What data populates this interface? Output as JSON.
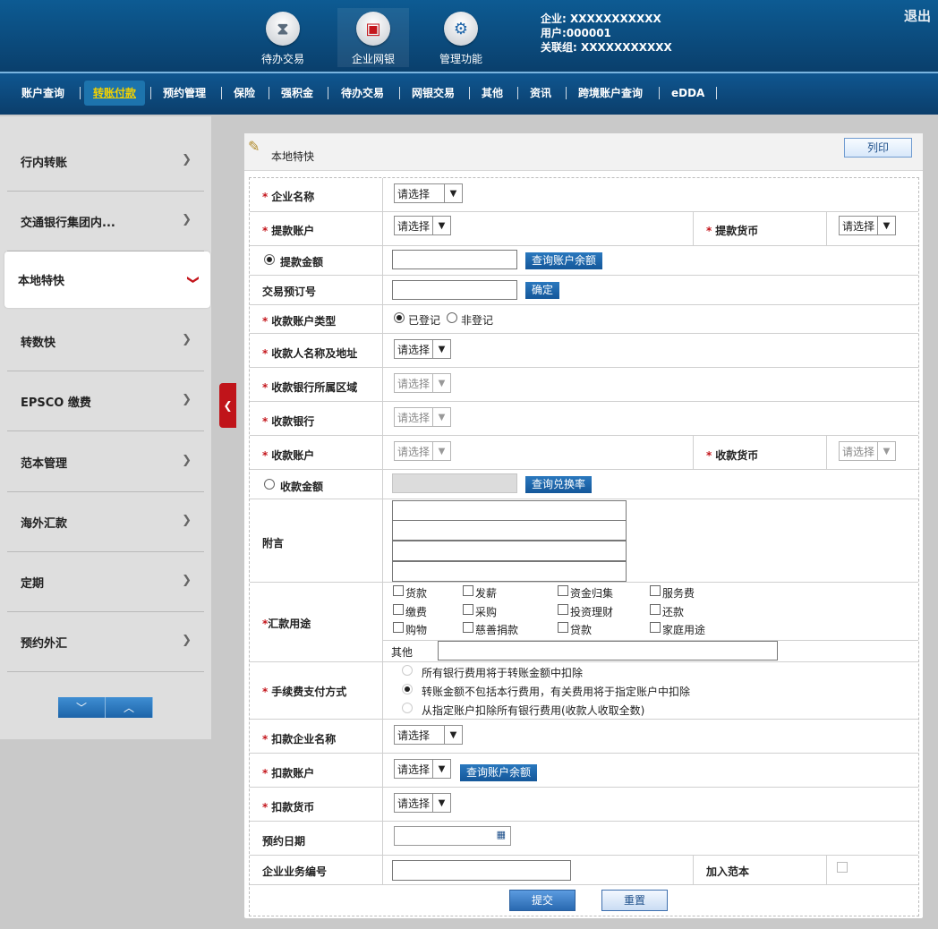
{
  "header": {
    "icons": [
      {
        "label": "待办交易",
        "icon": "hourglass-icon"
      },
      {
        "label": "企业网银",
        "icon": "monitor-icon"
      },
      {
        "label": "管理功能",
        "icon": "gear-icon"
      }
    ],
    "company_line": "企业: XXXXXXXXXXX",
    "user_line": "用户:000001",
    "group_line": "关联组: XXXXXXXXXXX",
    "logout": "退出"
  },
  "nav": [
    "账户查询",
    "转账付款",
    "预约管理",
    "保险",
    "强积金",
    "待办交易",
    "网银交易",
    "其他",
    "资讯",
    "跨境账户查询",
    "eDDA"
  ],
  "sidebar": {
    "items": [
      "行内转账",
      "交通银行集团内...",
      "本地特快",
      "转数快",
      "EPSCO 缴费",
      "范本管理",
      "海外汇款",
      "定期",
      "预约外汇"
    ],
    "active": "本地特快"
  },
  "panel": {
    "title": "本地特快",
    "print": "列印"
  },
  "form": {
    "company_name": "企业名称",
    "debit_account": "提款账户",
    "debit_currency": "提款货币",
    "debit_amount": "提款金额",
    "query_balance": "查询账户余额",
    "booking_no": "交易预订号",
    "confirm": "确定",
    "payee_account_type": "收款账户类型",
    "registered": "已登记",
    "unregistered": "非登记",
    "payee_name_addr": "收款人名称及地址",
    "payee_bank_region": "收款银行所属区域",
    "payee_bank": "收款银行",
    "payee_account": "收款账户",
    "payee_currency": "收款货币",
    "payee_amount": "收款金额",
    "query_rate": "查询兑换率",
    "remarks": "附言",
    "purpose": "汇款用途",
    "purposes": [
      "货款",
      "发薪",
      "资金归集",
      "服务费",
      "缴费",
      "采购",
      "投资理财",
      "还款",
      "购物",
      "慈善捐款",
      "贷款",
      "家庭用途"
    ],
    "other": "其他",
    "fee_method": "手续费支付方式",
    "fee_options": [
      "所有银行费用将于转账金额中扣除",
      "转账金额不包括本行费用，有关费用将于指定账户中扣除",
      "从指定账户扣除所有银行费用(收款人收取全数)"
    ],
    "fee_company": "扣款企业名称",
    "fee_account": "扣款账户",
    "fee_currency": "扣款货币",
    "appointment_date": "预约日期",
    "biz_ref": "企业业务编号",
    "add_template": "加入范本",
    "select_placeholder": "请选择",
    "submit": "提交",
    "reset": "重置"
  }
}
